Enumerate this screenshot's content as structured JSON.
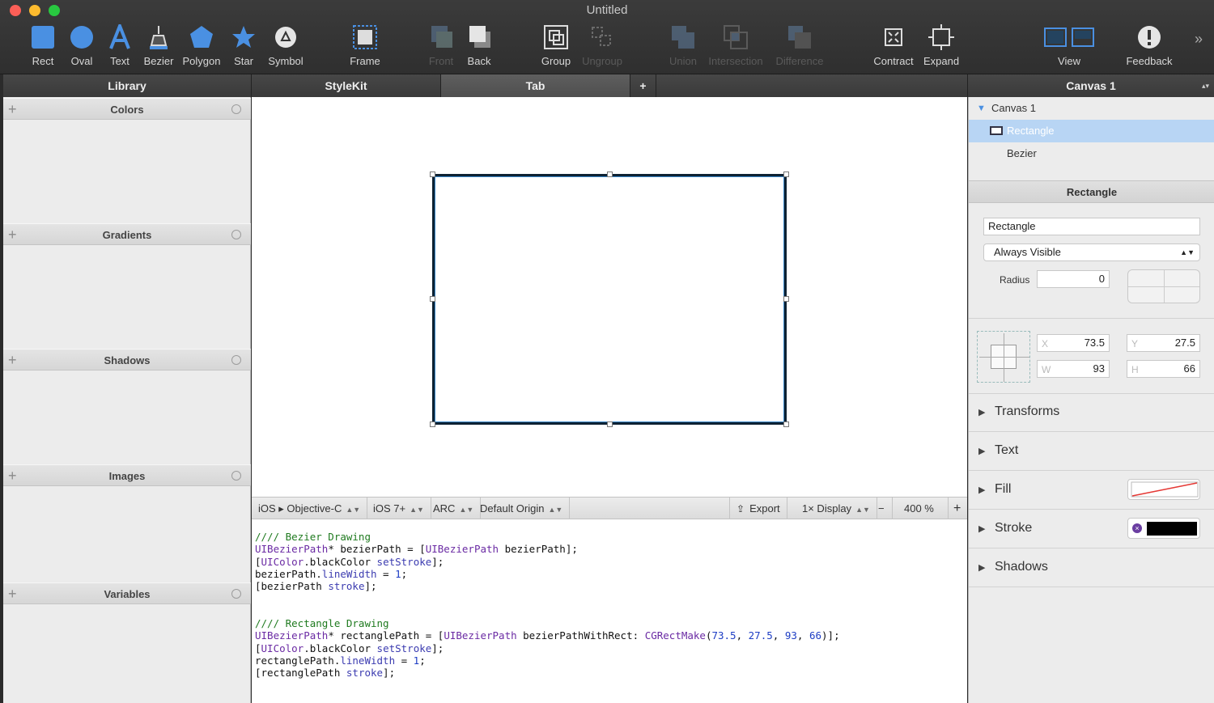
{
  "window": {
    "title": "Untitled"
  },
  "toolbar": {
    "items": [
      {
        "label": "Rect",
        "icon": "rect-icon",
        "enabled": true
      },
      {
        "label": "Oval",
        "icon": "oval-icon",
        "enabled": true
      },
      {
        "label": "Text",
        "icon": "text-icon",
        "enabled": true
      },
      {
        "label": "Bezier",
        "icon": "bezier-pen-icon",
        "enabled": true
      },
      {
        "label": "Polygon",
        "icon": "polygon-icon",
        "enabled": true
      },
      {
        "label": "Star",
        "icon": "star-icon",
        "enabled": true
      },
      {
        "label": "Symbol",
        "icon": "symbol-icon",
        "enabled": true
      },
      {
        "label": "Frame",
        "icon": "frame-icon",
        "enabled": true
      },
      {
        "label": "Front",
        "icon": "bring-front-icon",
        "enabled": false
      },
      {
        "label": "Back",
        "icon": "send-back-icon",
        "enabled": true
      },
      {
        "label": "Group",
        "icon": "group-icon",
        "enabled": true
      },
      {
        "label": "Ungroup",
        "icon": "ungroup-icon",
        "enabled": false
      },
      {
        "label": "Union",
        "icon": "union-icon",
        "enabled": false
      },
      {
        "label": "Intersection",
        "icon": "intersection-icon",
        "enabled": false
      },
      {
        "label": "Difference",
        "icon": "difference-icon",
        "enabled": false
      },
      {
        "label": "Contract",
        "icon": "contract-icon",
        "enabled": true
      },
      {
        "label": "Expand",
        "icon": "expand-icon",
        "enabled": true
      },
      {
        "label": "View",
        "icon": "view-icon",
        "enabled": true
      },
      {
        "label": "Feedback",
        "icon": "feedback-icon",
        "enabled": true
      }
    ],
    "overflow": "»"
  },
  "headers": {
    "library": "Library",
    "tabs": [
      "StyleKit",
      "Tab"
    ],
    "add_tab": "+",
    "canvas_select": "Canvas 1"
  },
  "library": {
    "sections": [
      "Colors",
      "Gradients",
      "Shadows",
      "Images",
      "Variables"
    ],
    "add": "+"
  },
  "codebar": {
    "platform": "iOS ▸ Objective-C",
    "version": "iOS 7+",
    "memory": "ARC",
    "origin": "Default Origin",
    "export": "Export",
    "display": "1× Display",
    "zoom_out": "−",
    "zoom": "400 %",
    "zoom_in": "+"
  },
  "code": {
    "bezier": {
      "comment": "//// Bezier Drawing",
      "l1_cls": "UIBezierPath",
      "l1_rest": "* bezierPath = [",
      "l1_cls2": "UIBezierPath",
      "l1_msg": " bezierPath",
      "l1_end": "];",
      "l2_pre": "[",
      "l2_cls": "UIColor",
      "l2_msg": ".blackColor",
      "l2_sel": " setStroke",
      "l2_end": "];",
      "l3_pre": "bezierPath.",
      "l3_prop": "lineWidth",
      "l3_mid": " = ",
      "l3_num": "1",
      "l3_end": ";",
      "l4_pre": "[bezierPath ",
      "l4_sel": "stroke",
      "l4_end": "];"
    },
    "rect": {
      "comment": "//// Rectangle Drawing",
      "l1_cls": "UIBezierPath",
      "l1_rest": "* rectanglePath = [",
      "l1_cls2": "UIBezierPath",
      "l1_msg": " bezierPathWithRect",
      "l1_mid": ": ",
      "l1_fn": "CGRectMake",
      "l1_open": "(",
      "n1": "73.5",
      "sep1": ", ",
      "n2": "27.5",
      "sep2": ", ",
      "n3": "93",
      "sep3": ", ",
      "n4": "66",
      "l1_end": ")];",
      "l2_pre": "[",
      "l2_cls": "UIColor",
      "l2_msg": ".blackColor",
      "l2_sel": " setStroke",
      "l2_end": "];",
      "l3_pre": "rectanglePath.",
      "l3_prop": "lineWidth",
      "l3_mid": " = ",
      "l3_num": "1",
      "l3_end": ";",
      "l4_pre": "[rectanglePath ",
      "l4_sel": "stroke",
      "l4_end": "];"
    }
  },
  "inspector": {
    "tree": [
      {
        "label": "Canvas 1",
        "kind": "canvas"
      },
      {
        "label": "Rectangle",
        "kind": "rect",
        "selected": true
      },
      {
        "label": "Bezier",
        "kind": "bezier"
      }
    ],
    "title": "Rectangle",
    "name_value": "Rectangle",
    "visibility": "Always Visible",
    "radius_label": "Radius",
    "radius_value": "0",
    "x_label": "X",
    "x": "73.5",
    "y_label": "Y",
    "y": "27.5",
    "w_label": "W",
    "w": "93",
    "h_label": "H",
    "h": "66",
    "sections": [
      "Transforms",
      "Text",
      "Fill",
      "Stroke",
      "Shadows"
    ],
    "stroke_color": "#000000",
    "selection_color": "#b8d5f4"
  }
}
